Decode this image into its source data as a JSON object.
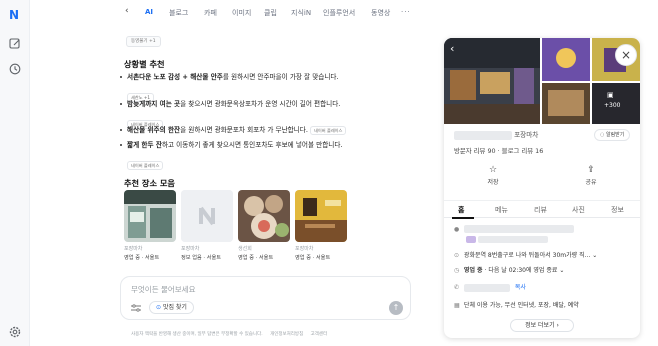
{
  "leftbar": {
    "logo": "N"
  },
  "tabs": [
    "AI",
    "블로그",
    "카페",
    "이미지",
    "클립",
    "지식iN",
    "인플루언서",
    "동영상"
  ],
  "filter_pill": "동영불기 +1",
  "situation": {
    "heading": "상황별 추천",
    "items": [
      {
        "bold": "서촌다운 노포 감성 + 해산물 안주",
        "rest": "를 원하시면 안주마을이 가장 잘 맞습니다.",
        "chip": "세찬노 +1"
      },
      {
        "bold": "밤늦게까지 여는 곳",
        "rest": "을 찾으시면 광화문옥상포차가 운영 시간이 길어 편합니다.",
        "chip": "네이버 플레이스"
      },
      {
        "bold": "해산물 위주의 한잔",
        "rest": "을 원하시면 광화문포차 회포차 가 무난합니다.",
        "chip": "네이버 플레이스",
        "inline_chip": true
      },
      {
        "bold": "짧게 한두 잔",
        "rest": "하고 이동하기 좋게 찾으시면 통인포차도 후보에 넣어볼 만합니다.",
        "chip": "네이버 플레이스"
      }
    ]
  },
  "places": {
    "heading": "추천 장소 모음",
    "cards": [
      {
        "cat": "포장마차",
        "stat": "영업 중 · 서울트"
      },
      {
        "cat": "포장마차",
        "stat": "정보 업음 · 서울트"
      },
      {
        "cat": "생선회",
        "stat": "영업 중 · 서울트"
      },
      {
        "cat": "포장마차",
        "stat": "영업 중 · 서울트"
      }
    ]
  },
  "ask": {
    "placeholder": "무엇이든 물어보세요",
    "chip_label": "맛집 찾기"
  },
  "footer": {
    "notice": "사용자 맥락을 반영해 생산 중이며, 일부 답변은 부정확할 수 있습니다.",
    "links": [
      "개인정보처리방침",
      "고객센터"
    ]
  },
  "detail": {
    "category": "포장마차",
    "save_label": "알림받기",
    "reviews": "방문자 리뷰 90 · 블로그 리뷰 16",
    "photo_count": "+300",
    "actions": [
      {
        "icon": "star-icon",
        "label": "저장"
      },
      {
        "icon": "share-icon",
        "label": "공유"
      }
    ],
    "tabs": [
      "홈",
      "메뉴",
      "리뷰",
      "사진",
      "정보"
    ],
    "address": "광화문역 8번출구로 나와 뒤돌아서 30m가량 직...",
    "hours_status": "영업 중",
    "hours_detail": "· 다음 날 02:30에 영업 종료",
    "copy_label": "복사",
    "services": "단체 이용 가능, 무선 인터넷, 포장, 배달, 예약",
    "more_label": "정보 더보기"
  },
  "colors": {
    "accent": "#1b6ef3"
  }
}
